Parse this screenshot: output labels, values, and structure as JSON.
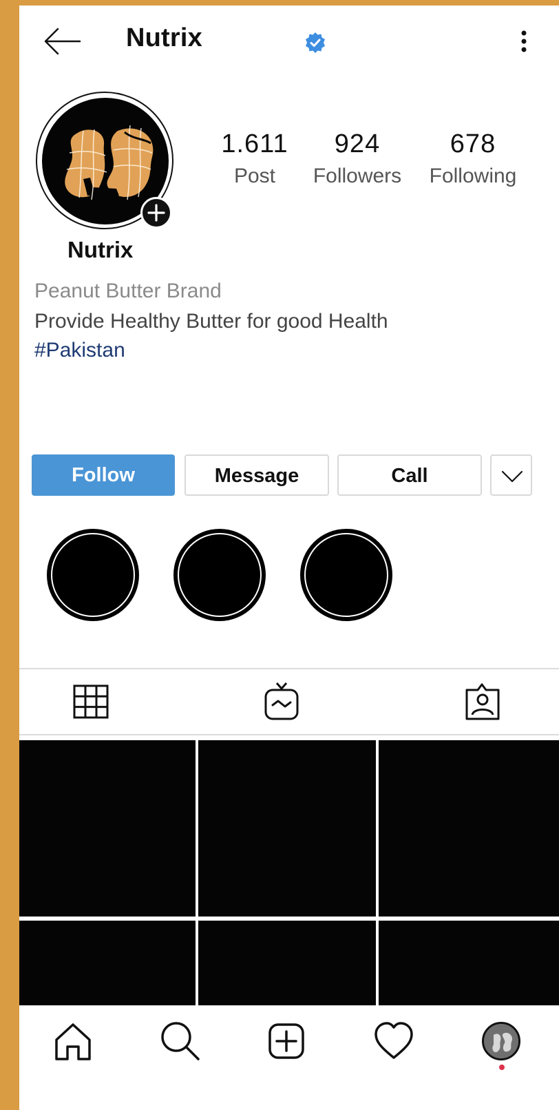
{
  "header": {
    "back_icon": "arrow-left-icon",
    "title": "Nutrix",
    "verified_icon": "verified-badge-icon",
    "more_icon": "more-vertical-icon"
  },
  "profile": {
    "avatar_icon": "peanut-logo",
    "add_icon": "plus-circle-icon",
    "display_name": "Nutrix",
    "stats": [
      {
        "value": "1.611",
        "label": "Post"
      },
      {
        "value": "924",
        "label": "Followers"
      },
      {
        "value": "678",
        "label": "Following"
      }
    ],
    "bio": {
      "category": "Peanut Butter Brand",
      "text": "Provide Healthy Butter for good Health",
      "hashtag": "#Pakistan"
    }
  },
  "actions": {
    "follow": "Follow",
    "message": "Message",
    "call": "Call",
    "more_icon": "chevron-down-icon"
  },
  "highlights": [
    "",
    "",
    ""
  ],
  "tabs": [
    "grid-icon",
    "igtv-icon",
    "tagged-icon"
  ],
  "nav": [
    "home-icon",
    "search-icon",
    "add-post-icon",
    "heart-icon",
    "profile-avatar"
  ],
  "colors": {
    "accent": "#4A95D6",
    "background_frame": "#D99C43",
    "hashtag": "#1f3b73",
    "notification_dot": "#e0314b",
    "peanut": "#E1A257"
  }
}
